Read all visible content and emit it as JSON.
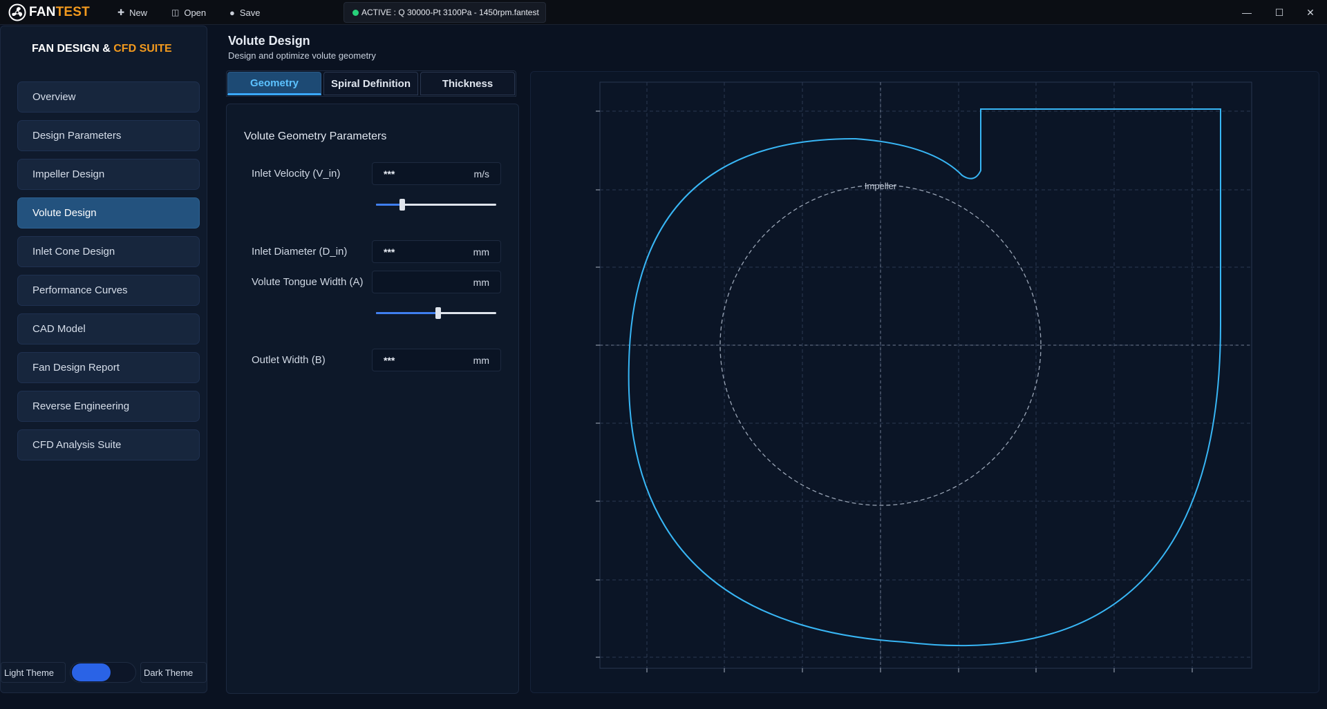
{
  "app": {
    "logo_fan": "FAN",
    "logo_test": "TEST",
    "actions": [
      {
        "label": "New",
        "icon": "plus-icon"
      },
      {
        "label": "Open",
        "icon": "open-icon"
      },
      {
        "label": "Save",
        "icon": "save-icon"
      }
    ],
    "status": {
      "prefix": "ACTIVE : ",
      "file": "Q 30000-Pt 3100Pa - 1450rpm.fantest",
      "color": "#27d17a"
    },
    "window": {
      "minimize": "—",
      "maximize": "☐",
      "close": "✕"
    }
  },
  "sidebar": {
    "brand_main": "FAN DESIGN & ",
    "brand_accent": "CFD SUITE",
    "items": [
      {
        "label": "Overview"
      },
      {
        "label": "Design Parameters"
      },
      {
        "label": "Impeller Design"
      },
      {
        "label": "Volute Design",
        "active": true
      },
      {
        "label": "Inlet Cone Design"
      },
      {
        "label": "Performance Curves"
      },
      {
        "label": "CAD Model"
      },
      {
        "label": "Fan Design Report"
      },
      {
        "label": "Reverse Engineering"
      },
      {
        "label": "CFD Analysis Suite"
      }
    ],
    "theme": {
      "light": "Light Theme",
      "dark": "Dark Theme",
      "mode": "dark"
    }
  },
  "header": {
    "title": "Volute Design",
    "subtitle": "Design and optimize volute geometry"
  },
  "tabs": [
    {
      "label": "Geometry",
      "active": true
    },
    {
      "label": "Spiral Definition"
    },
    {
      "label": "Thickness"
    }
  ],
  "params": {
    "title": "Volute Geometry Parameters",
    "inlet_velocity": {
      "label": "Inlet Velocity (V_in)",
      "value": "***",
      "unit": "m/s",
      "slider": 0.22
    },
    "inlet_diameter": {
      "label": "Inlet Diameter (D_in)",
      "value": "***",
      "unit": "mm"
    },
    "tongue_width": {
      "label": "Volute Tongue Width (A)",
      "value": "",
      "unit": "mm",
      "slider": 0.52
    },
    "outlet_width": {
      "label": "Outlet Width (B)",
      "value": "***",
      "unit": "mm"
    }
  },
  "canvas": {
    "impeller_label": "Impeller",
    "volute_color": "#38b6f5",
    "impeller_color": "#9aa5b6"
  }
}
